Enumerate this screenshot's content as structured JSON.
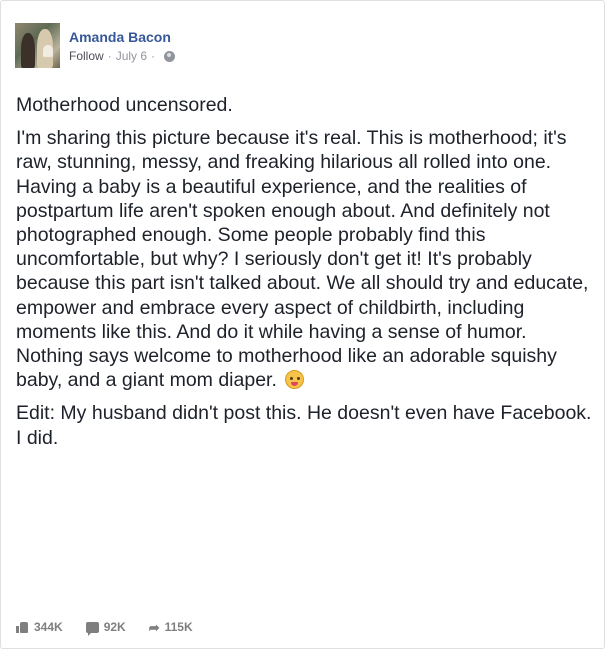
{
  "post": {
    "author": "Amanda Bacon",
    "follow_label": "Follow",
    "separator": "·",
    "date": "July 6",
    "separator2": "·",
    "privacy_icon": "globe-icon",
    "title": "Motherhood uncensored.",
    "body": "I'm sharing this picture because it's real. This is motherhood; it's raw, stunning, messy, and freaking hilarious all rolled into one. Having a baby is a beautiful experience, and the realities of postpartum life aren't spoken enough about. And definitely not photographed enough. Some people probably find this uncomfortable, but why? I seriously don't get it! It's probably because this part isn't talked about. We all should try and educate, empower and embrace every aspect of childbirth, including moments like this. And do it while having a sense of humor. Nothing says welcome to motherhood like an adorable squishy baby, and a giant mom diaper.",
    "emoji_icon": "tongue-out-emoji-icon",
    "edit": "Edit: My husband didn't post this. He doesn't even have Facebook. I did."
  },
  "stats": {
    "likes": "344K",
    "comments": "92K",
    "shares": "115K"
  },
  "colors": {
    "author_link": "#365899",
    "body_text": "#1d2129",
    "meta_text": "#90949c",
    "stats_text": "#7f7f7f"
  }
}
